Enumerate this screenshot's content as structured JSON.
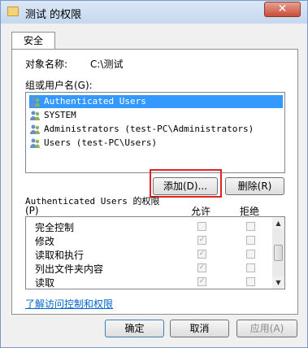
{
  "window": {
    "title": "测试 的权限",
    "close_glyph": "✕"
  },
  "tabs": [
    {
      "label": "安全"
    }
  ],
  "object": {
    "label": "对象名称:",
    "value": "C:\\测试"
  },
  "groups": {
    "label": "组或用户名(G):",
    "items": [
      {
        "name": "Authenticated Users",
        "icon": "users-icon",
        "selected": true
      },
      {
        "name": "SYSTEM",
        "icon": "users-icon",
        "selected": false
      },
      {
        "name": "Administrators (test-PC\\Administrators)",
        "icon": "users-icon",
        "selected": false
      },
      {
        "name": "Users (test-PC\\Users)",
        "icon": "users-icon",
        "selected": false
      }
    ]
  },
  "buttons": {
    "add": "添加(D)...",
    "remove": "删除(R)"
  },
  "permissions": {
    "title": "Authenticated Users 的权限",
    "title_suffix": "(P)",
    "allow_header": "允许",
    "deny_header": "拒绝",
    "rows": [
      {
        "name": "完全控制",
        "allow": false,
        "deny": false
      },
      {
        "name": "修改",
        "allow": true,
        "deny": false
      },
      {
        "name": "读取和执行",
        "allow": true,
        "deny": false
      },
      {
        "name": "列出文件夹内容",
        "allow": true,
        "deny": false
      },
      {
        "name": "读取",
        "allow": true,
        "deny": false
      }
    ]
  },
  "link": "了解访问控制和权限",
  "footer": {
    "ok": "确定",
    "cancel": "取消",
    "apply": "应用(A)"
  },
  "colors": {
    "selection": "#3399ff",
    "highlight_box": "#e02424",
    "link": "#0066cc"
  }
}
